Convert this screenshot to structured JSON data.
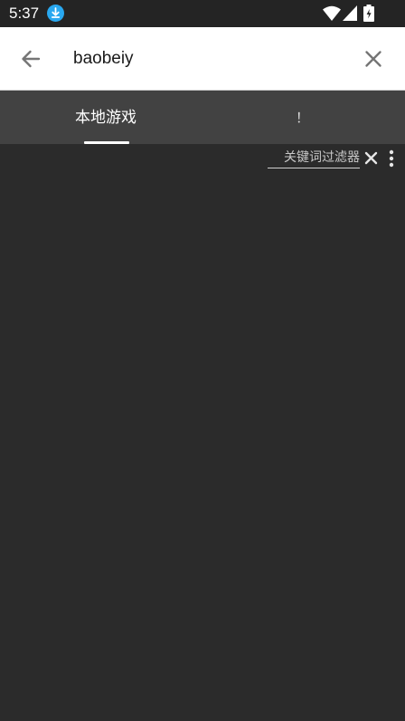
{
  "status_bar": {
    "time": "5:37",
    "icons": [
      "download-icon",
      "wifi-icon",
      "signal-icon",
      "battery-charging-icon"
    ],
    "download_icon_color": "#29a8f0"
  },
  "search_bar": {
    "back_icon": "arrow-left-icon",
    "query": "baobeiy",
    "clear_icon": "close-icon"
  },
  "tabs": [
    {
      "label": "本地游戏",
      "selected": true
    },
    {
      "label": "！",
      "selected": false
    }
  ],
  "filter": {
    "placeholder": "关键词过滤器",
    "value": "",
    "clear_icon": "close-icon",
    "more_icon": "more-vertical-icon"
  },
  "colors": {
    "status_bar_bg": "#242424",
    "toolbar_bg": "#ffffff",
    "tab_bar_bg": "#424242",
    "content_bg": "#2b2b2b",
    "tab_indicator": "#ffffff"
  }
}
